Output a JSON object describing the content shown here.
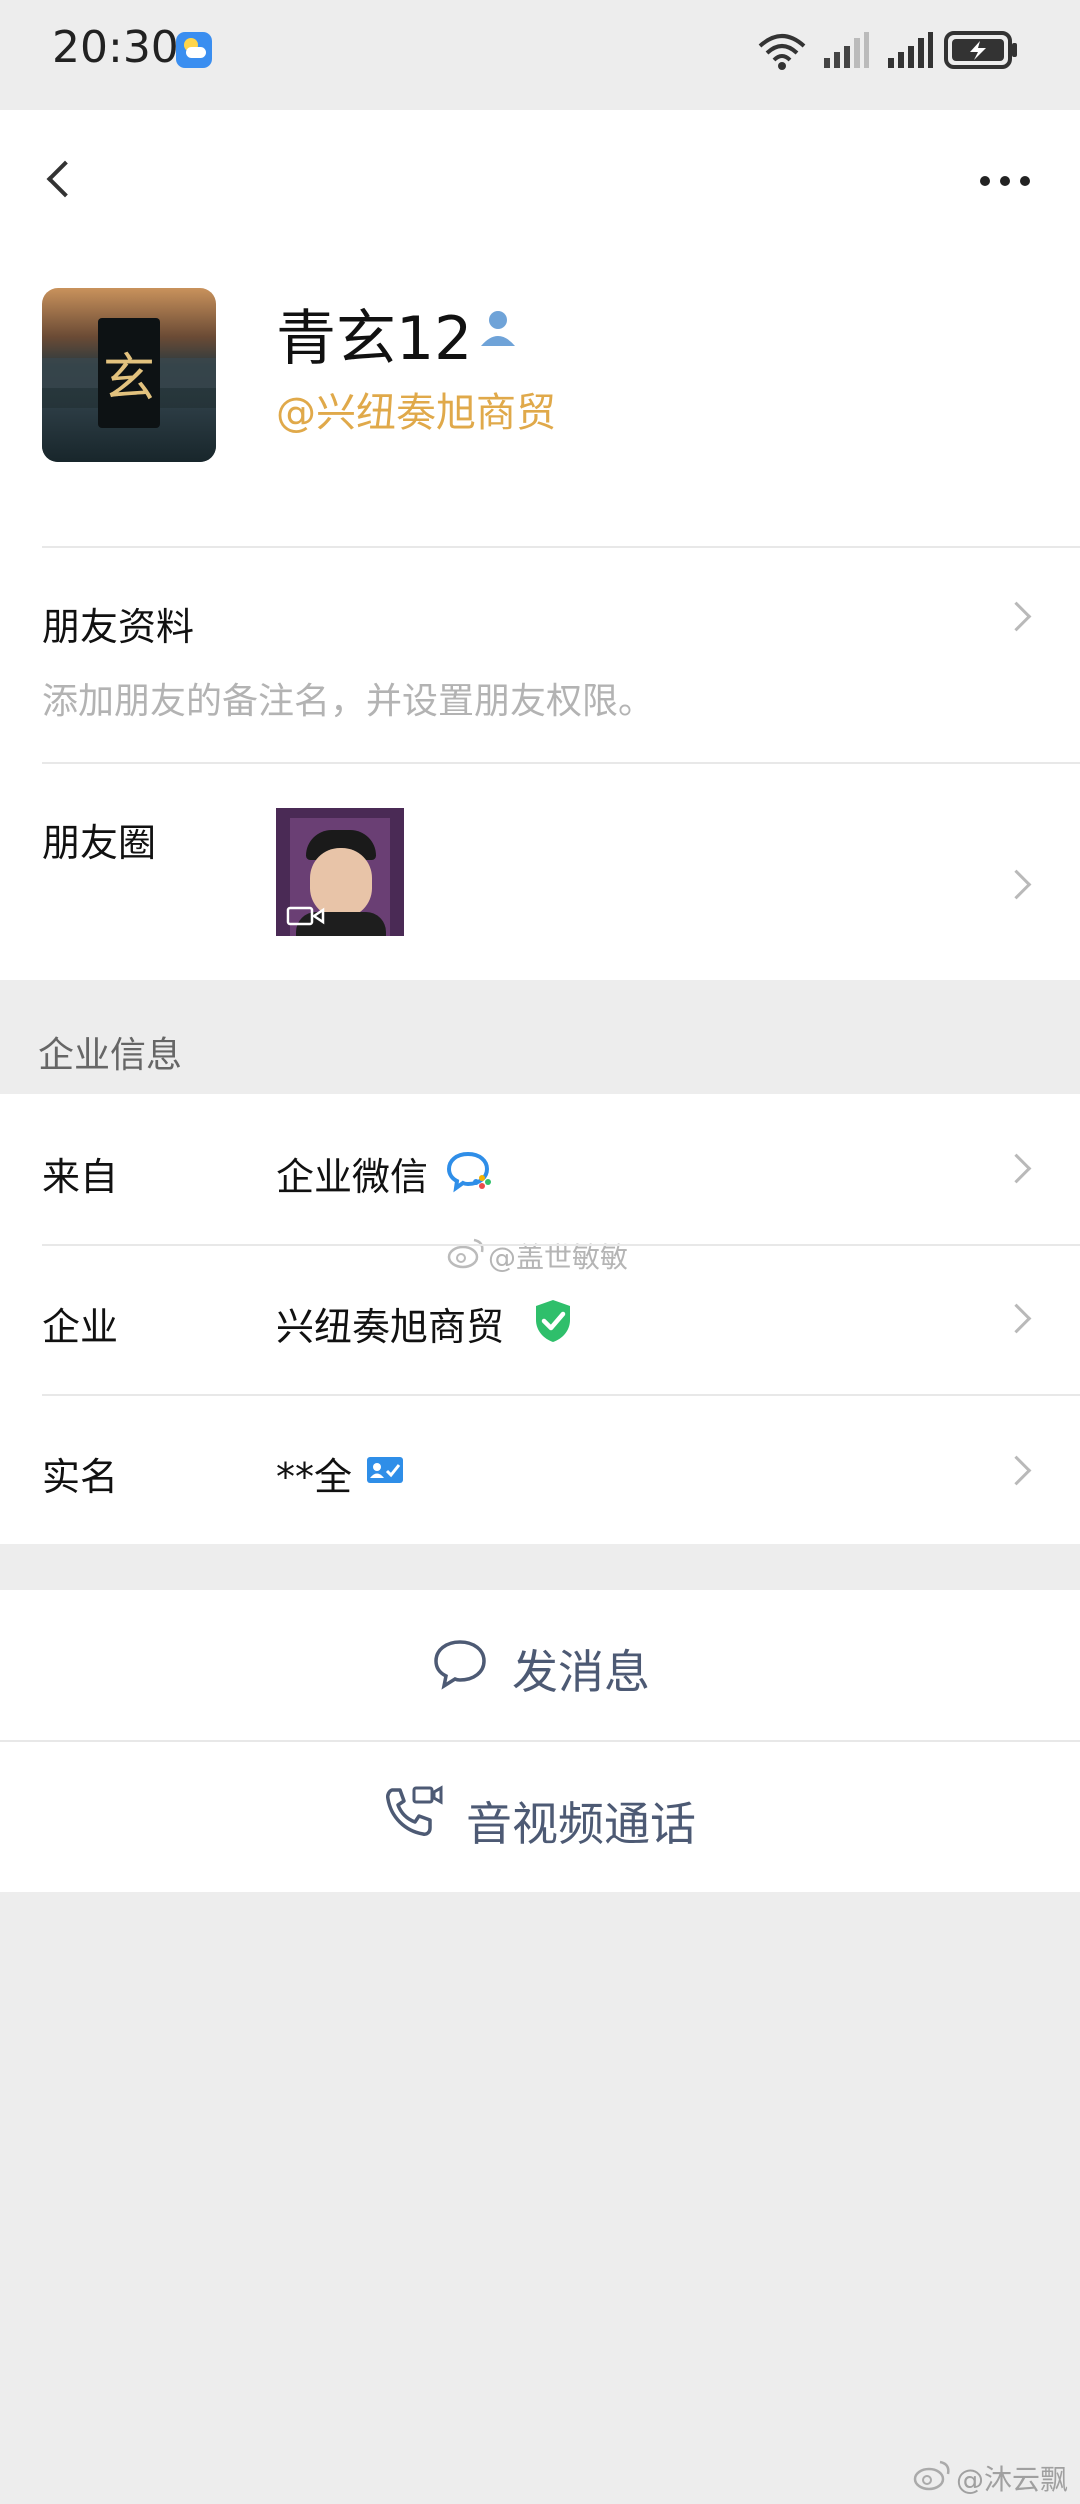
{
  "status_bar": {
    "time": "20:30"
  },
  "profile": {
    "name": "青玄12",
    "company_handle": "@兴纽奏旭商贸",
    "avatar_text": "玄"
  },
  "friend_info": {
    "label": "朋友资料",
    "hint": "添加朋友的备注名，并设置朋友权限。"
  },
  "moments": {
    "label": "朋友圈"
  },
  "enterprise": {
    "section_title": "企业信息",
    "rows": [
      {
        "label": "来自",
        "value": "企业微信"
      },
      {
        "label": "企业",
        "value": "兴纽奏旭商贸"
      },
      {
        "label": "实名",
        "value": "**全"
      }
    ]
  },
  "actions": {
    "message": "发消息",
    "call": "音视频通话"
  },
  "watermarks": {
    "center": "@盖世敏敏",
    "bottom": "@沐云飘"
  },
  "colors": {
    "accent_orange": "#e0a94a",
    "action_blue_gray": "#4d5a74",
    "verified_green": "#2fbf6b",
    "background": "#ededed"
  }
}
